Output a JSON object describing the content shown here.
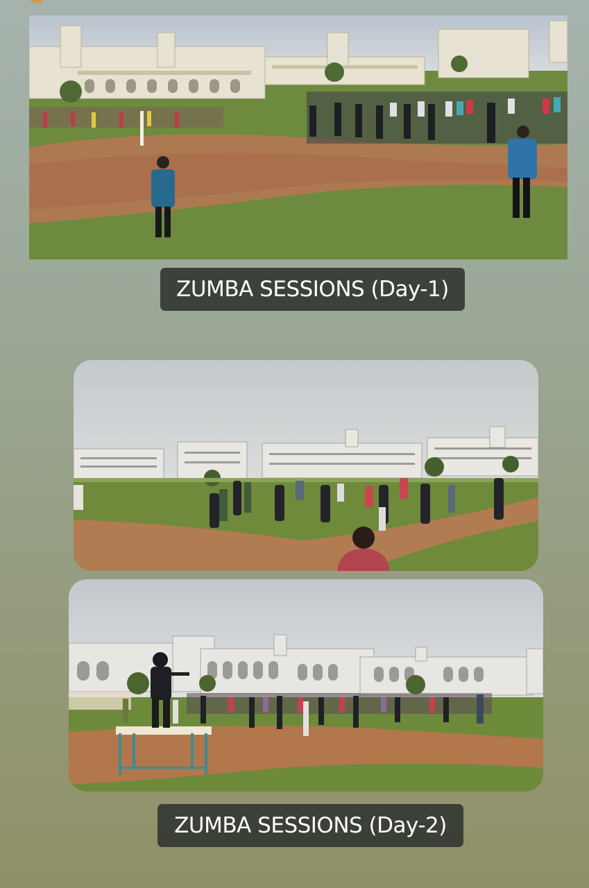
{
  "story": {
    "photos": [
      {
        "subject": "outdoor-zumba-session-field-view"
      },
      {
        "subject": "outdoor-zumba-session-instructor-facing-group"
      },
      {
        "subject": "outdoor-zumba-session-instructor-on-table"
      }
    ],
    "captions": {
      "day1": "ZUMBA SESSIONS (Day-1)",
      "day2": "ZUMBA SESSIONS (Day-2)"
    },
    "colors": {
      "caption_bg": "#343834",
      "caption_text": "#ffffff",
      "grass": "#6f8a3c",
      "dirt": "#b9724c",
      "sky": "#c8cfd4",
      "building": "#e6e2d4"
    }
  }
}
